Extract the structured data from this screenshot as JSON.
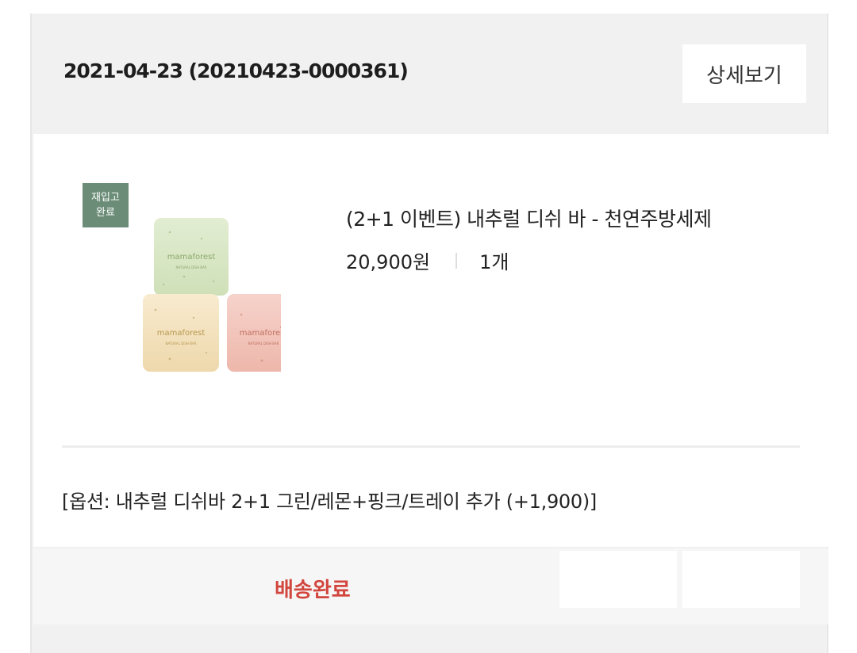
{
  "order": {
    "date_and_number": "2021-04-23 (20210423-0000361)",
    "detail_button": "상세보기"
  },
  "product": {
    "badge_line1": "재입고",
    "badge_line2": "완료",
    "name": "(2+1 이벤트) 내추럴 디쉬 바 - 천연주방세제",
    "price": "20,900원",
    "quantity": "1개",
    "image_brand_text": "mamaforest",
    "image_sub_text": "NATURAL DISH BAR",
    "option": "[옵션: 내추럴 디쉬바 2+1 그린/레몬+핑크/트레이 추가 (+1,900)]"
  },
  "footer": {
    "status": "배송완료",
    "status_color": "#d2463e"
  },
  "colors": {
    "badge": "#6b8d77",
    "soap_green": "#d7e6c3",
    "soap_yellow": "#f5e4c2",
    "soap_pink": "#f3c8bf"
  }
}
